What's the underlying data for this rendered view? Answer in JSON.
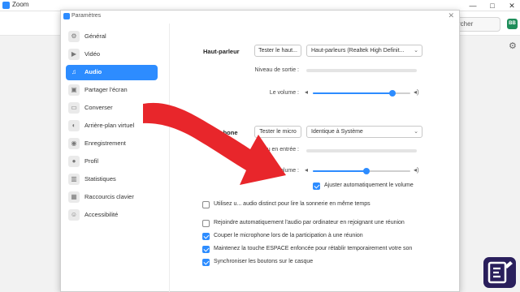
{
  "app": {
    "title": "Zoom",
    "window_controls": [
      "—",
      "□",
      "✕"
    ],
    "search_label": "rcher",
    "avatar_initials": "BB"
  },
  "dialog": {
    "title": "Paramètres",
    "close": "✕"
  },
  "sidebar": {
    "items": [
      {
        "label": "Général",
        "icon": "gear-icon"
      },
      {
        "label": "Vidéo",
        "icon": "video-icon"
      },
      {
        "label": "Audio",
        "icon": "headphones-icon",
        "active": true
      },
      {
        "label": "Partager l'écran",
        "icon": "share-screen-icon"
      },
      {
        "label": "Converser",
        "icon": "chat-icon"
      },
      {
        "label": "Arrière-plan virtuel",
        "icon": "virtual-background-icon"
      },
      {
        "label": "Enregistrement",
        "icon": "record-icon"
      },
      {
        "label": "Profil",
        "icon": "profile-icon"
      },
      {
        "label": "Statistiques",
        "icon": "statistics-icon"
      },
      {
        "label": "Raccourcis clavier",
        "icon": "keyboard-icon"
      },
      {
        "label": "Accessibilité",
        "icon": "accessibility-icon"
      }
    ]
  },
  "speaker": {
    "section_label": "Haut-parleur",
    "test_button": "Tester le haut...",
    "device": "Haut-parleurs (Realtek High Definit...",
    "output_level_label": "Niveau de sortie :",
    "volume_label": "Le volume :",
    "volume_level": 0.82
  },
  "microphone": {
    "section_label": "Microphone",
    "test_button": "Tester le micro",
    "device": "Identique à Système",
    "input_level_label": "Niveau en entrée :",
    "volume_label": "Le volume :",
    "volume_level": 0.55,
    "auto_adjust_label": "Ajuster automatiquement le volume",
    "auto_adjust_checked": true
  },
  "options": [
    {
      "label": "Utilisez u... audio distinct pour lire la sonnerie en même temps",
      "checked": false
    },
    {
      "label": "Rejoindre automatiquement l'audio par ordinateur en rejoignant une réunion",
      "checked": false
    },
    {
      "label": "Couper le microphone lors de la participation à une réunion",
      "checked": true
    },
    {
      "label": "Maintenez la touche ESPACE enfoncée pour rétablir temporairement votre son",
      "checked": true
    },
    {
      "label": "Synchroniser les boutons sur le casque",
      "checked": true
    }
  ],
  "colors": {
    "accent": "#2d8cff",
    "arrow": "#e8262b"
  }
}
